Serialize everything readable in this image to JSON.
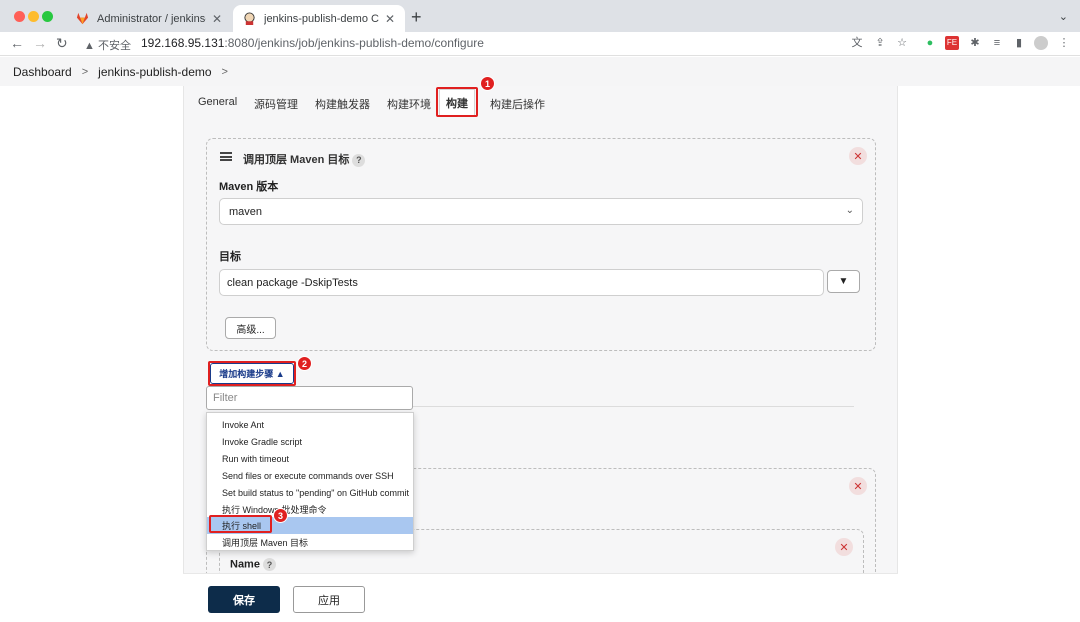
{
  "browser": {
    "tabs": [
      {
        "title": "Administrator / jenkins-publish"
      },
      {
        "title": "jenkins-publish-demo Config [Jenkins]"
      }
    ],
    "insecure_label": "不安全",
    "url_host": "192.168.95.131",
    "url_rest": ":8080/jenkins/job/jenkins-publish-demo/configure"
  },
  "breadcrumb": {
    "items": [
      "Dashboard",
      "jenkins-publish-demo"
    ]
  },
  "config_tabs": [
    "General",
    "源码管理",
    "构建触发器",
    "构建环境",
    "构建",
    "构建后操作"
  ],
  "markers": [
    "1",
    "2",
    "3"
  ],
  "maven_step": {
    "title": "调用顶层 Maven 目标",
    "help": "?",
    "maven_version_label": "Maven 版本",
    "maven_version_value": "maven",
    "goals_label": "目标",
    "goals_value": "clean package -DskipTests",
    "expand_button": "▼",
    "advanced_button": "高级..."
  },
  "add_step_button": "增加构建步骤 ▲",
  "filter_placeholder": "Filter",
  "dropdown_items": [
    "Invoke Ant",
    "Invoke Gradle script",
    "Run with timeout",
    "Send files or execute commands over SSH",
    "Set build status to \"pending\" on GitHub commit",
    "执行 Windows 批处理命令",
    "执行 shell",
    "调用顶层 Maven 目标"
  ],
  "lower_step": {
    "name_label": "Name",
    "help": "?"
  },
  "footer": {
    "save": "保存",
    "apply": "应用"
  },
  "colors": {
    "accent_red": "#e02020",
    "save_button": "#0d2c4a",
    "link_blue": "#1a3b8a",
    "highlight": "#a9c7f0"
  }
}
